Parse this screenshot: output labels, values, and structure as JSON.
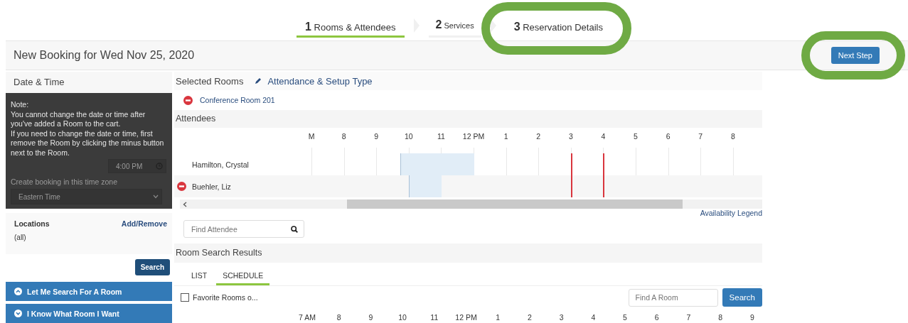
{
  "steps": [
    {
      "number": "1",
      "label": "Rooms & Attendees",
      "selected": true,
      "highlighted": false
    },
    {
      "number": "2",
      "label": "Services",
      "selected": false,
      "highlighted": false
    },
    {
      "number": "3",
      "label": "Reservation Details",
      "selected": false,
      "highlighted": true
    }
  ],
  "header": {
    "title": "New Booking for Wed Nov 25, 2020",
    "next_button": {
      "label": "Next Step",
      "highlighted": true
    }
  },
  "sidebar": {
    "title": "Date & Time",
    "note": {
      "heading": "Note:",
      "lines": [
        "You cannot change the date or time after you've added a Room to the cart.",
        "If you need to change the date or time, first remove the Room by clicking the minus button next to the Room."
      ]
    },
    "end_time": "4:00 PM",
    "timezone_label": "Create booking in this time zone",
    "timezone": "Eastern Time",
    "locations": {
      "label": "Locations",
      "link": "Add/Remove",
      "value": "(all)"
    },
    "search_button": "Search",
    "panels": [
      {
        "label": "Let Me Search For A Room",
        "expanded": true
      },
      {
        "label": "I Know What Room I Want",
        "expanded": false
      }
    ]
  },
  "selected_rooms": {
    "title": "Selected Rooms",
    "edit_link": "Attendance & Setup Type",
    "rooms": [
      "Conference Room 201"
    ]
  },
  "attendees": {
    "title": "Attendees",
    "hours": [
      "M",
      "8",
      "9",
      "10",
      "11",
      "12 PM",
      "1",
      "2",
      "3",
      "4",
      "5",
      "6",
      "7",
      "8"
    ],
    "people": [
      {
        "name": "Hamilton, Crystal",
        "removable": false
      },
      {
        "name": "Buehler, Liz",
        "removable": true
      }
    ],
    "legend_link": "Availability Legend",
    "find_placeholder": "Find Attendee"
  },
  "room_search": {
    "title": "Room Search Results",
    "tabs": [
      {
        "label": "LIST",
        "selected": false
      },
      {
        "label": "SCHEDULE",
        "selected": true
      }
    ],
    "favorites": {
      "label": "Favorite Rooms o...",
      "checked": false
    },
    "find_placeholder": "Find A Room",
    "search_button": "Search",
    "hours": [
      "7 AM",
      "8",
      "9",
      "10",
      "11",
      "12 PM",
      "1",
      "2",
      "3",
      "4",
      "5",
      "6",
      "7",
      "8",
      "9"
    ]
  }
}
